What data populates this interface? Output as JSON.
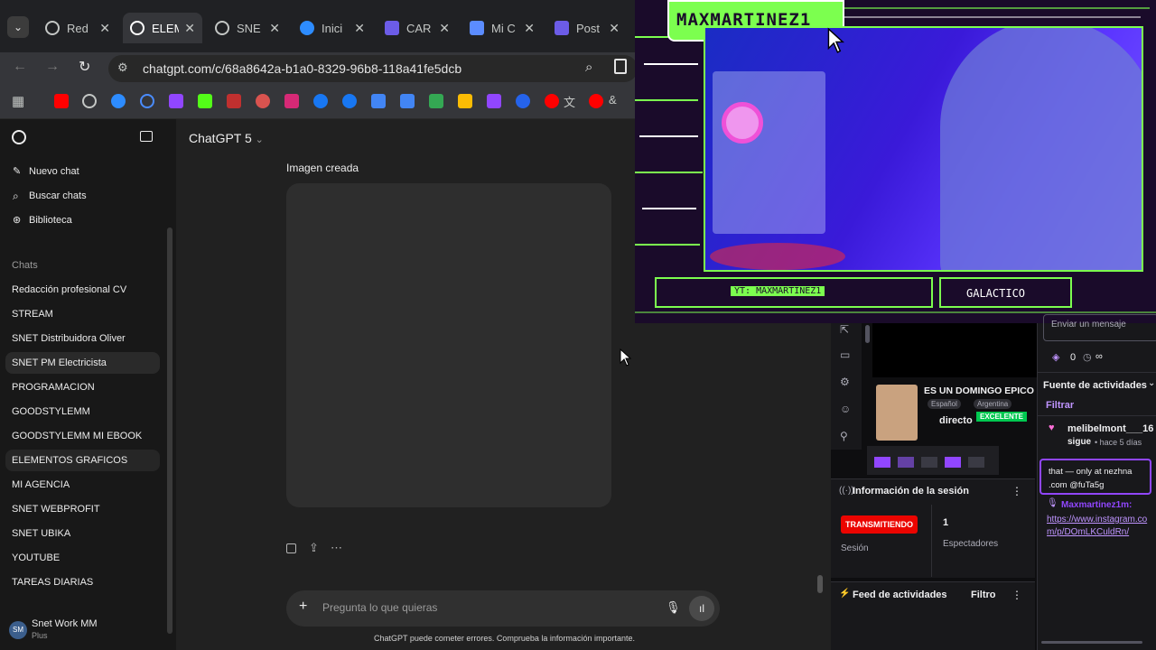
{
  "tabs": [
    {
      "label": "Red",
      "icon": "openai-icon",
      "active": false
    },
    {
      "label": "ELEM",
      "icon": "openai-icon",
      "active": true
    },
    {
      "label": "SNE",
      "icon": "openai-icon",
      "active": false
    },
    {
      "label": "Inici",
      "icon": "canva-icon",
      "active": false
    },
    {
      "label": "CAR",
      "icon": "heart-shield-icon",
      "active": false
    },
    {
      "label": "Mi C",
      "icon": "window-icon",
      "active": false
    },
    {
      "label": "Post",
      "icon": "heart-shield-icon",
      "active": false
    }
  ],
  "url": "chatgpt.com/c/68a8642a-b1a0-8329-96b8-118a41fe5dcb",
  "header": {
    "model": "ChatGPT 5"
  },
  "sidebar": {
    "new_chat": "Nuevo chat",
    "search": "Buscar chats",
    "library": "Biblioteca",
    "section": "Chats",
    "chats": [
      "Redacción profesional CV",
      "STREAM",
      "SNET Distribuidora Oliver",
      "SNET PM Electricista",
      "PROGRAMACION",
      "GOODSTYLEMM",
      "GOODSTYLEMM MI EBOOK",
      "ELEMENTOS GRAFICOS",
      "MI AGENCIA",
      "SNET WEBPROFIT",
      "SNET UBIKA",
      "YOUTUBE",
      "TAREAS DIARIAS"
    ],
    "user": {
      "initials": "SM",
      "name": "Snet Work MM",
      "plan": "Plus"
    }
  },
  "chat": {
    "image_label": "Imagen creada",
    "composer_placeholder": "Pregunta lo que quieras",
    "disclaimer": "ChatGPT puede cometer errores. Comprueba la información importante."
  },
  "overlay": {
    "username": "MAXMARTINEZ1",
    "yt_label": "YT: MAXMARTINEZ1",
    "tag": "GALACTICO"
  },
  "twitch": {
    "chat_placeholder": "Enviar un mensaje",
    "points": "0",
    "infinity": "∞",
    "stream_title": "ES UN DOMINGO EPICO",
    "tags": [
      "Español",
      "Argentina"
    ],
    "badge": "EXCELENTE",
    "live_label": "directo",
    "activity_source": "Fuente de actividades",
    "filter": "Filtrar",
    "event_user": "melibelmont___16",
    "event_action": "sigue",
    "event_time": "• hace 5 días",
    "chat_msg1": "that — only at nezhna .com @fuTa5g",
    "chat_user2": "Maxmartinez1m:",
    "chat_link": "https://www.instagram.com/p/DOmLKCuldRn/",
    "session_title": "Información de la sesión",
    "status": "TRANSMITIENDO",
    "session_label": "Sesión",
    "viewers": "1",
    "viewers_label": "Espectadores",
    "feed_title": "Feed de actividades",
    "feed_filter": "Filtro"
  },
  "colors": {
    "accent_green": "#7cff4f",
    "twitch_purple": "#bf94ff",
    "live_red": "#eb0400",
    "chat_bg": "#212121",
    "sidebar_bg": "#181818"
  }
}
